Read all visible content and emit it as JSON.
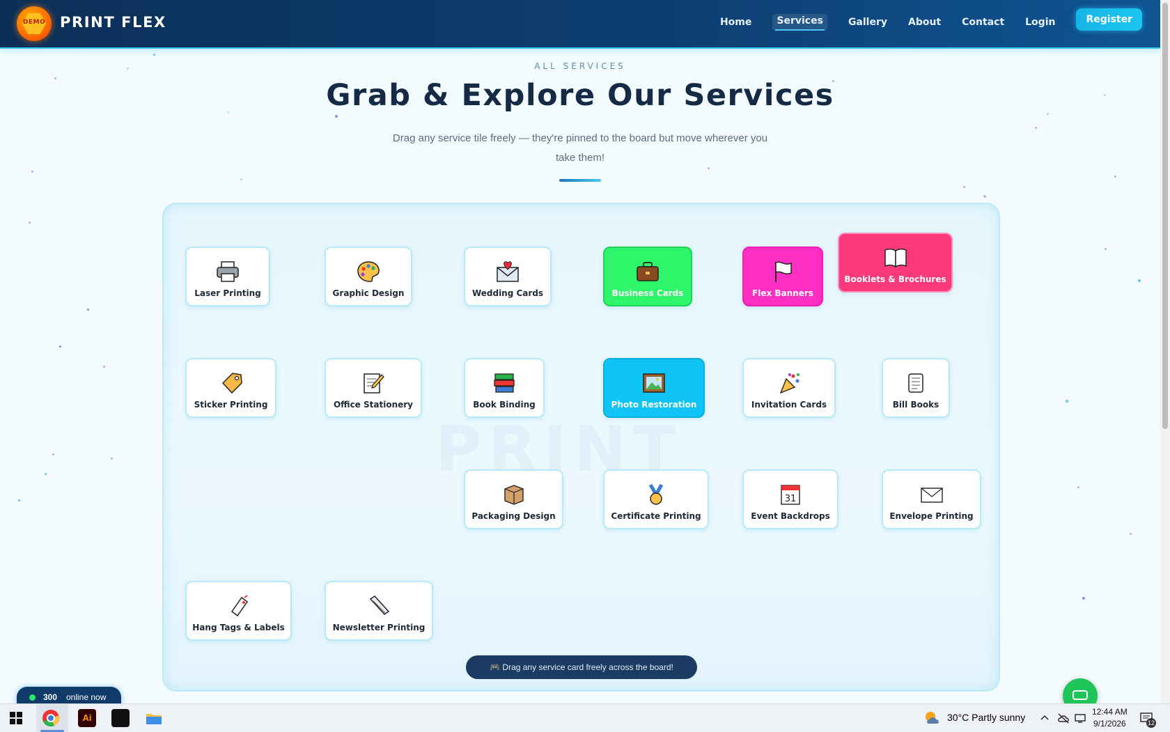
{
  "brand": {
    "badge": "DEMO",
    "name": "PRINT FLEX"
  },
  "nav": {
    "items": [
      {
        "label": "Home"
      },
      {
        "label": "Services"
      },
      {
        "label": "Gallery"
      },
      {
        "label": "About"
      },
      {
        "label": "Contact"
      },
      {
        "label": "Login"
      },
      {
        "label": "Register"
      }
    ],
    "active": "Services"
  },
  "intro": {
    "eyebrow": "ALL SERVICES",
    "title": "Grab & Explore Our Services",
    "subtitle": "Drag any service tile freely — they're pinned to the board but move wherever you take them!"
  },
  "board": {
    "watermark": "PRINT",
    "hint": "🎮 Drag any service card freely across the board!",
    "tiles": [
      {
        "label": "Laser Printing",
        "icon": "printer-icon"
      },
      {
        "label": "Graphic Design",
        "icon": "palette-icon"
      },
      {
        "label": "Wedding Cards",
        "icon": "love-letter-icon"
      },
      {
        "label": "Business Cards",
        "icon": "briefcase-icon"
      },
      {
        "label": "Flex Banners",
        "icon": "flag-icon"
      },
      {
        "label": "Booklets & Brochures",
        "icon": "open-book-icon"
      },
      {
        "label": "Sticker Printing",
        "icon": "tag-icon"
      },
      {
        "label": "Office Stationery",
        "icon": "memo-icon"
      },
      {
        "label": "Book Binding",
        "icon": "books-icon"
      },
      {
        "label": "Photo Restoration",
        "icon": "framed-picture-icon"
      },
      {
        "label": "Invitation Cards",
        "icon": "confetti-icon"
      },
      {
        "label": "Bill Books",
        "icon": "scroll-icon"
      },
      {
        "label": "Packaging Design",
        "icon": "package-icon"
      },
      {
        "label": "Certificate Printing",
        "icon": "medal-icon"
      },
      {
        "label": "Event Backdrops",
        "icon": "calendar-icon"
      },
      {
        "label": "Envelope Printing",
        "icon": "envelope-icon"
      },
      {
        "label": "Hang Tags & Labels",
        "icon": "label-tag-icon"
      },
      {
        "label": "Newsletter Printing",
        "icon": "pen-icon"
      }
    ]
  },
  "online": {
    "count": "300",
    "text": "online now"
  },
  "taskbar": {
    "weather": "30°C  Partly sunny",
    "time": "12:44 AM",
    "date": "9/1/2026",
    "notifications": "12",
    "apps": [
      "start-icon",
      "chrome-icon",
      "illustrator-icon",
      "app-icon",
      "file-explorer-icon"
    ]
  },
  "colors": {
    "header": "#0d3d70",
    "accent": "#39c4ee",
    "green_tile": "#2ef56a",
    "magenta_tile": "#ff2fc4",
    "pink_tile": "#ff3a7c",
    "cyan_tile": "#10c4f8"
  }
}
